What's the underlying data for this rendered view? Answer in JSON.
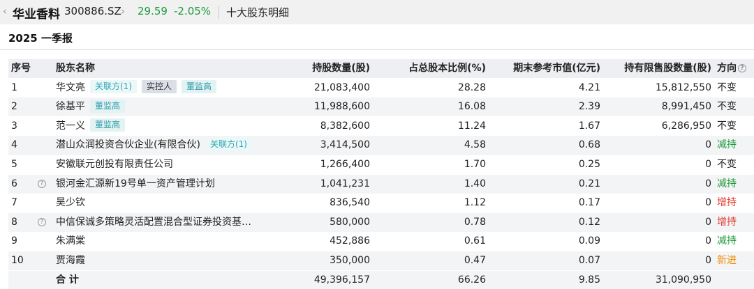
{
  "header": {
    "back_icon": "chevron-left-icon",
    "stock_name": "华业香料",
    "stock_code": "300886.SZ",
    "detail_chevron": "chevron-right-icon",
    "price": "29.59",
    "change": "-2.05%",
    "page_title": "十大股东明细",
    "change_color": "#1a9b3a"
  },
  "section": {
    "title": "2025 一季报"
  },
  "table": {
    "columns": {
      "idx": "序号",
      "name": "股东名称",
      "shares": "持股数量(股)",
      "pct": "占总股本比例(%)",
      "market_value": "期末参考市值(亿元)",
      "restricted": "持有限售股数量(股)",
      "direction": "方向"
    },
    "rows": [
      {
        "idx": "1",
        "help": false,
        "name": "华文亮",
        "tags": [
          "关联方(1)",
          "实控人",
          "董监高"
        ],
        "shares": "21,083,400",
        "pct": "28.28",
        "market_value": "4.21",
        "restricted": "15,812,550",
        "direction": "不变"
      },
      {
        "idx": "2",
        "help": false,
        "name": "徐基平",
        "tags": [
          "董监高"
        ],
        "shares": "11,988,600",
        "pct": "16.08",
        "market_value": "2.39",
        "restricted": "8,991,450",
        "direction": "不变"
      },
      {
        "idx": "3",
        "help": false,
        "name": "范一义",
        "tags": [
          "董监高"
        ],
        "shares": "8,382,600",
        "pct": "11.24",
        "market_value": "1.67",
        "restricted": "6,286,950",
        "direction": "不变"
      },
      {
        "idx": "4",
        "help": false,
        "name": "潜山众润投资合伙企业(有限合伙)",
        "tags": [
          "关联方(1)"
        ],
        "shares": "3,414,500",
        "pct": "4.58",
        "market_value": "0.68",
        "restricted": "0",
        "direction": "减持"
      },
      {
        "idx": "5",
        "help": false,
        "name": "安徽联元创投有限责任公司",
        "tags": [],
        "shares": "1,266,400",
        "pct": "1.70",
        "market_value": "0.25",
        "restricted": "0",
        "direction": "不变"
      },
      {
        "idx": "6",
        "help": true,
        "name": "银河金汇源新19号单一资产管理计划",
        "tags": [],
        "shares": "1,041,231",
        "pct": "1.40",
        "market_value": "0.21",
        "restricted": "0",
        "direction": "减持"
      },
      {
        "idx": "7",
        "help": false,
        "name": "吴少钦",
        "tags": [],
        "shares": "836,540",
        "pct": "1.12",
        "market_value": "0.17",
        "restricted": "0",
        "direction": "增持"
      },
      {
        "idx": "8",
        "help": true,
        "name": "中信保诚多策略灵活配置混合型证券投资基…",
        "tags": [],
        "shares": "580,000",
        "pct": "0.78",
        "market_value": "0.12",
        "restricted": "0",
        "direction": "增持"
      },
      {
        "idx": "9",
        "help": false,
        "name": "朱满棠",
        "tags": [],
        "shares": "452,886",
        "pct": "0.61",
        "market_value": "0.09",
        "restricted": "0",
        "direction": "减持"
      },
      {
        "idx": "10",
        "help": false,
        "name": "贾海霞",
        "tags": [],
        "shares": "350,000",
        "pct": "0.47",
        "market_value": "0.07",
        "restricted": "0",
        "direction": "新进"
      }
    ],
    "total": {
      "label": "合 计",
      "shares": "49,396,157",
      "pct": "66.26",
      "market_value": "9.85",
      "restricted": "31,090,950"
    }
  },
  "colors": {
    "decrease": "#1f9a3b",
    "increase": "#e23a2e",
    "new": "#f08c00",
    "unchanged": "#222222"
  }
}
